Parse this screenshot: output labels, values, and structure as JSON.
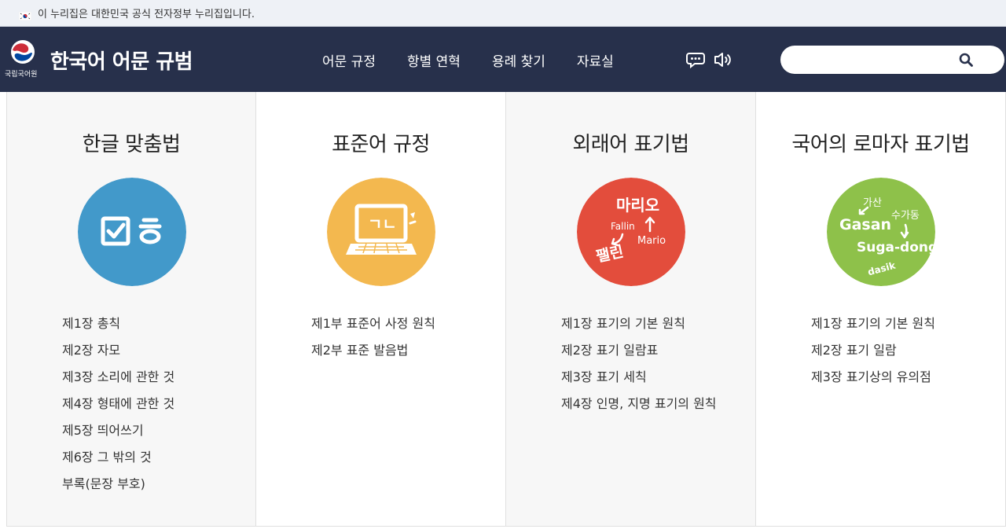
{
  "gov_banner": {
    "text": "이 누리집은 대한민국 공식 전자정부 누리집입니다."
  },
  "header": {
    "org_name": "국립국어원",
    "site_title": "한국어 어문 규범",
    "nav": [
      "어문 규정",
      "항별 연혁",
      "용례 찾기",
      "자료실"
    ],
    "search": {
      "placeholder": ""
    },
    "colors": {
      "header_bg": "#27304b",
      "banner_bg": "#eef1f6"
    }
  },
  "cards": [
    {
      "title": "한글 맞춤법",
      "icon": "checkbox-hieut-icon",
      "circle_color": "#4299ca",
      "links": [
        "제1장 총칙",
        "제2장 자모",
        "제3장 소리에 관한 것",
        "제4장 형태에 관한 것",
        "제5장 띄어쓰기",
        "제6장 그 밖의 것",
        "부록(문장 부호)"
      ]
    },
    {
      "title": "표준어 규정",
      "icon": "laptop-icon",
      "circle_color": "#f3b84f",
      "laptop_text": "ㄱㄴ",
      "links": [
        "제1부 표준어 사정 원칙",
        "제2부 표준 발음법"
      ]
    },
    {
      "title": "외래어 표기법",
      "icon": "loanword-icon",
      "circle_color": "#e34d3c",
      "circle_words": [
        "마리오",
        "Fallin",
        "Mario",
        "팰린"
      ],
      "links": [
        "제1장 표기의 기본 원칙",
        "제2장 표기 일람표",
        "제3장 표기 세칙",
        "제4장 인명, 지명 표기의 원칙"
      ]
    },
    {
      "title": "국어의 로마자 표기법",
      "icon": "romanization-icon",
      "circle_color": "#8ec14a",
      "circle_words": [
        "가산",
        "Gasan",
        "수가동",
        "Suga-dong",
        "dasik"
      ],
      "links": [
        "제1장 표기의 기본 원칙",
        "제2장 표기 일람",
        "제3장 표기상의 유의점"
      ]
    }
  ]
}
